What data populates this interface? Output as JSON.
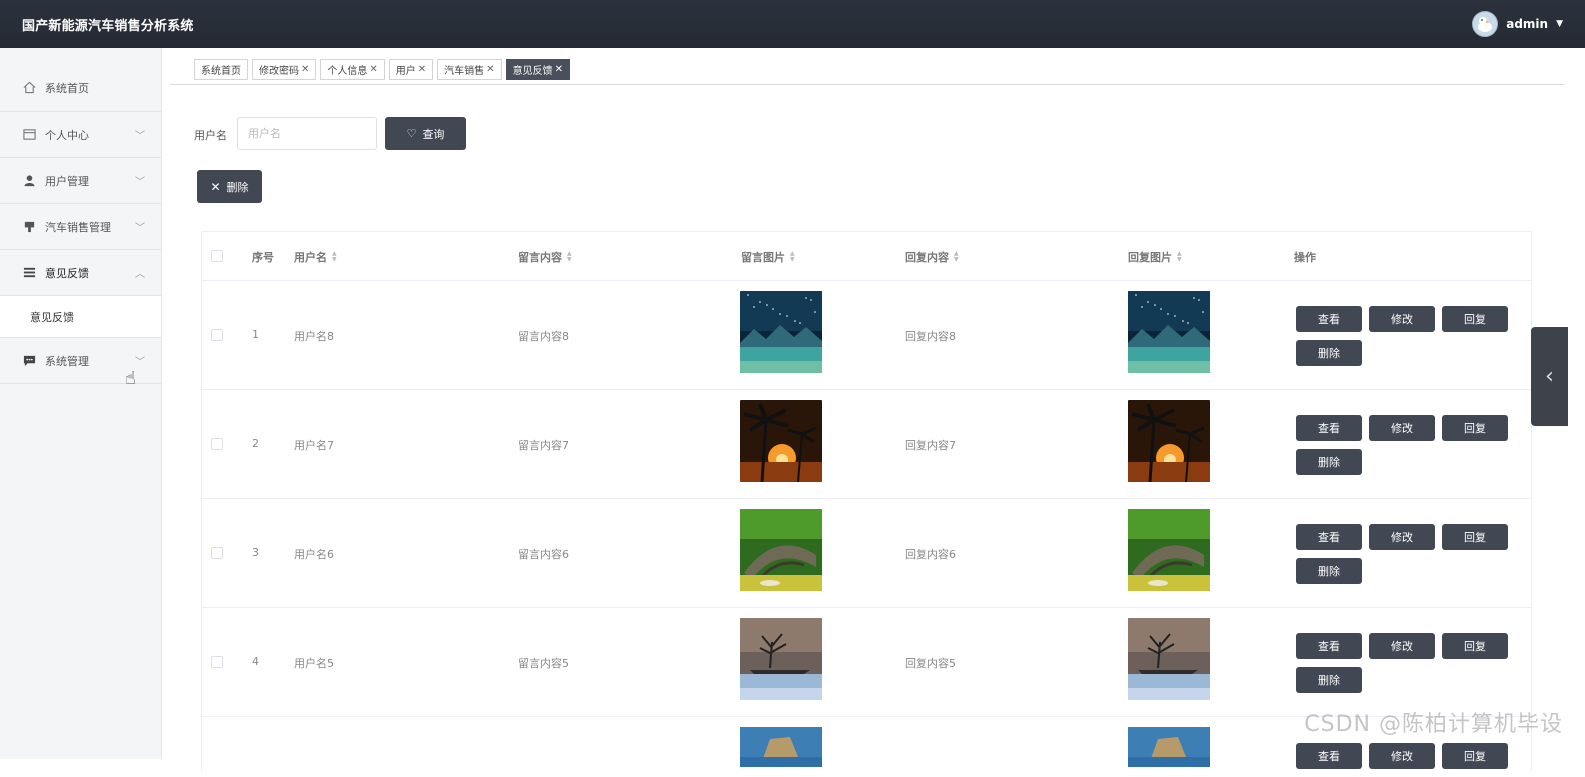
{
  "header": {
    "title": "国产新能源汽车销售分析系统",
    "user": "admin"
  },
  "sidebar": {
    "items": [
      {
        "label": "系统首页",
        "icon": "home-icon"
      },
      {
        "label": "个人中心",
        "icon": "card-icon"
      },
      {
        "label": "用户管理",
        "icon": "user-icon"
      },
      {
        "label": "汽车销售管理",
        "icon": "car-icon"
      },
      {
        "label": "意见反馈",
        "icon": "list-icon"
      },
      {
        "label": "系统管理",
        "icon": "chat-icon"
      }
    ],
    "submenu": "意见反馈"
  },
  "tabs": [
    {
      "label": "系统首页",
      "closable": false
    },
    {
      "label": "修改密码",
      "closable": true
    },
    {
      "label": "个人信息",
      "closable": true
    },
    {
      "label": "用户",
      "closable": true
    },
    {
      "label": "汽车销售",
      "closable": true
    },
    {
      "label": "意见反馈",
      "closable": true,
      "active": true
    }
  ],
  "search": {
    "label": "用户名",
    "placeholder": "用户名",
    "query_label": "查询"
  },
  "toolbar": {
    "delete_label": "删除"
  },
  "table": {
    "headers": {
      "index": "序号",
      "username": "用户名",
      "content": "留言内容",
      "image": "留言图片",
      "reply": "回复内容",
      "reply_image": "回复图片",
      "actions": "操作"
    },
    "rows": [
      {
        "index": "1",
        "username": "用户名8",
        "content": "留言内容8",
        "reply": "回复内容8",
        "scene": "starry-lake"
      },
      {
        "index": "2",
        "username": "用户名7",
        "content": "留言内容7",
        "reply": "回复内容7",
        "scene": "palm-sunset"
      },
      {
        "index": "3",
        "username": "用户名6",
        "content": "留言内容6",
        "reply": "回复内容6",
        "scene": "stone-bridge"
      },
      {
        "index": "4",
        "username": "用户名5",
        "content": "留言内容5",
        "reply": "回复内容5",
        "scene": "tree-dusk"
      }
    ],
    "actions": {
      "view": "查看",
      "edit": "修改",
      "reply": "回复",
      "delete": "删除"
    }
  },
  "watermark": "CSDN @陈柏计算机毕设"
}
